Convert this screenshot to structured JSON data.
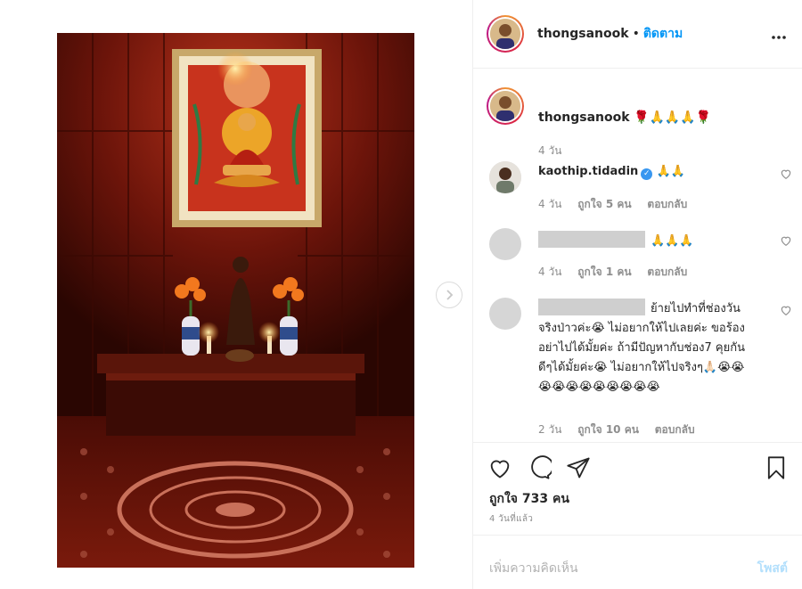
{
  "post": {
    "image_alt": "Shrine with Buddha painting, candles and flower vases",
    "next_icon": "chevron-right-icon"
  },
  "header": {
    "username": "thongsanook",
    "separator": "•",
    "follow_label": "ติดตาม",
    "more_icon": "more-horizontal-icon"
  },
  "caption": {
    "username": "thongsanook",
    "text": "🌹🙏🙏🙏🌹",
    "time": "4 วัน"
  },
  "comments": [
    {
      "username": "kaothip.tidadin",
      "verified": true,
      "text": "🙏🙏",
      "time": "4 วัน",
      "likes": "ถูกใจ 5 คน",
      "reply": "ตอบกลับ"
    },
    {
      "username": "",
      "text": "🙏🙏🙏",
      "time": "4 วัน",
      "likes": "ถูกใจ 1 คน",
      "reply": "ตอบกลับ"
    },
    {
      "username": "",
      "text": "ย้ายไปทำที่ช่องวันจริงป่าวค่ะ😭 ไม่อยากให้ไปเลยค่ะ ขอร้องอย่าไปได้มั้ยค่ะ ถ้ามีปัญหากับช่อง7 คุยกันดีๆได้มั้ยค่ะ😭 ไม่อยากให้ไปจริงๆ🙏🏻😭😭😭😭😭😭😭😭😭😭😭",
      "time": "2 วัน",
      "likes": "ถูกใจ 10 คน",
      "reply": "ตอบกลับ"
    }
  ],
  "actions": {
    "like_icon": "heart-icon",
    "comment_icon": "comment-icon",
    "share_icon": "share-icon",
    "save_icon": "bookmark-icon",
    "likes_text": "ถูกใจ 733 คน",
    "posted_ago": "4 วันที่แล้ว"
  },
  "add_comment": {
    "placeholder": "เพิ่มความคิดเห็น",
    "post_label": "โพสต์"
  },
  "colors": {
    "link_blue": "#0095f6",
    "post_disabled": "#b2dffc",
    "muted": "#8e8e8e"
  }
}
